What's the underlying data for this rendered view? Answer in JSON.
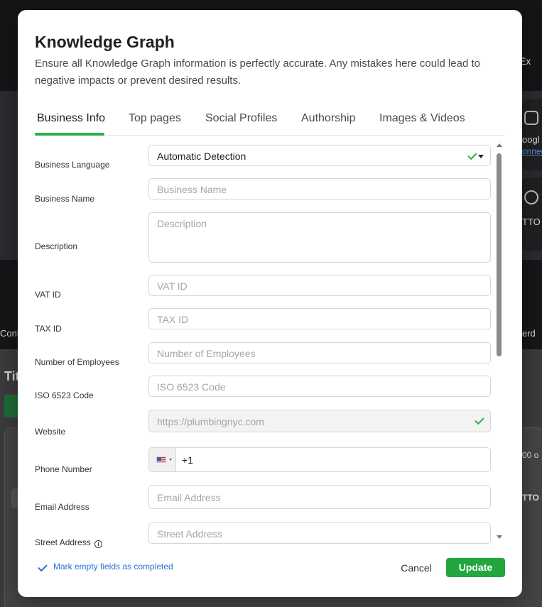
{
  "background": {
    "top_right_text": "Ex",
    "card_text_1": "oogl",
    "card_text_2": "onned",
    "card_text_3": "TTO",
    "left_text": "Cont",
    "right_text": "erd",
    "section_title": "Tit",
    "pager_text": "00 o",
    "right_badge": "TTO"
  },
  "modal": {
    "title": "Knowledge Graph",
    "subtitle": "Ensure all Knowledge Graph information is perfectly accurate. Any mistakes here could lead to negative impacts or prevent desired results.",
    "tabs": [
      {
        "label": "Business Info",
        "active": true
      },
      {
        "label": "Top pages",
        "active": false
      },
      {
        "label": "Social Profiles",
        "active": false
      },
      {
        "label": "Authorship",
        "active": false
      },
      {
        "label": "Images & Videos",
        "active": false
      }
    ],
    "fields": {
      "business_language": {
        "label": "Business Language",
        "value": "Automatic Detection"
      },
      "business_name": {
        "label": "Business Name",
        "placeholder": "Business Name"
      },
      "description": {
        "label": "Description",
        "placeholder": "Description"
      },
      "vat_id": {
        "label": "VAT ID",
        "placeholder": "VAT ID"
      },
      "tax_id": {
        "label": "TAX ID",
        "placeholder": "TAX ID"
      },
      "employees": {
        "label": "Number of Employees",
        "placeholder": "Number of Employees"
      },
      "iso_code": {
        "label": "ISO 6523 Code",
        "placeholder": "ISO 6523 Code"
      },
      "website": {
        "label": "Website",
        "value": "https://plumbingnyc.com"
      },
      "phone": {
        "label": "Phone Number",
        "value": "+1"
      },
      "email": {
        "label": "Email Address",
        "placeholder": "Email Address"
      },
      "street": {
        "label": "Street Address",
        "placeholder": "Street Address",
        "info": "i"
      }
    },
    "footer": {
      "mark_empty": "Mark empty fields as completed",
      "cancel": "Cancel",
      "update": "Update"
    }
  },
  "colors": {
    "accent_green": "#22a63f",
    "link_blue": "#2a6fd6",
    "tab_underline": "#2bb04a"
  }
}
